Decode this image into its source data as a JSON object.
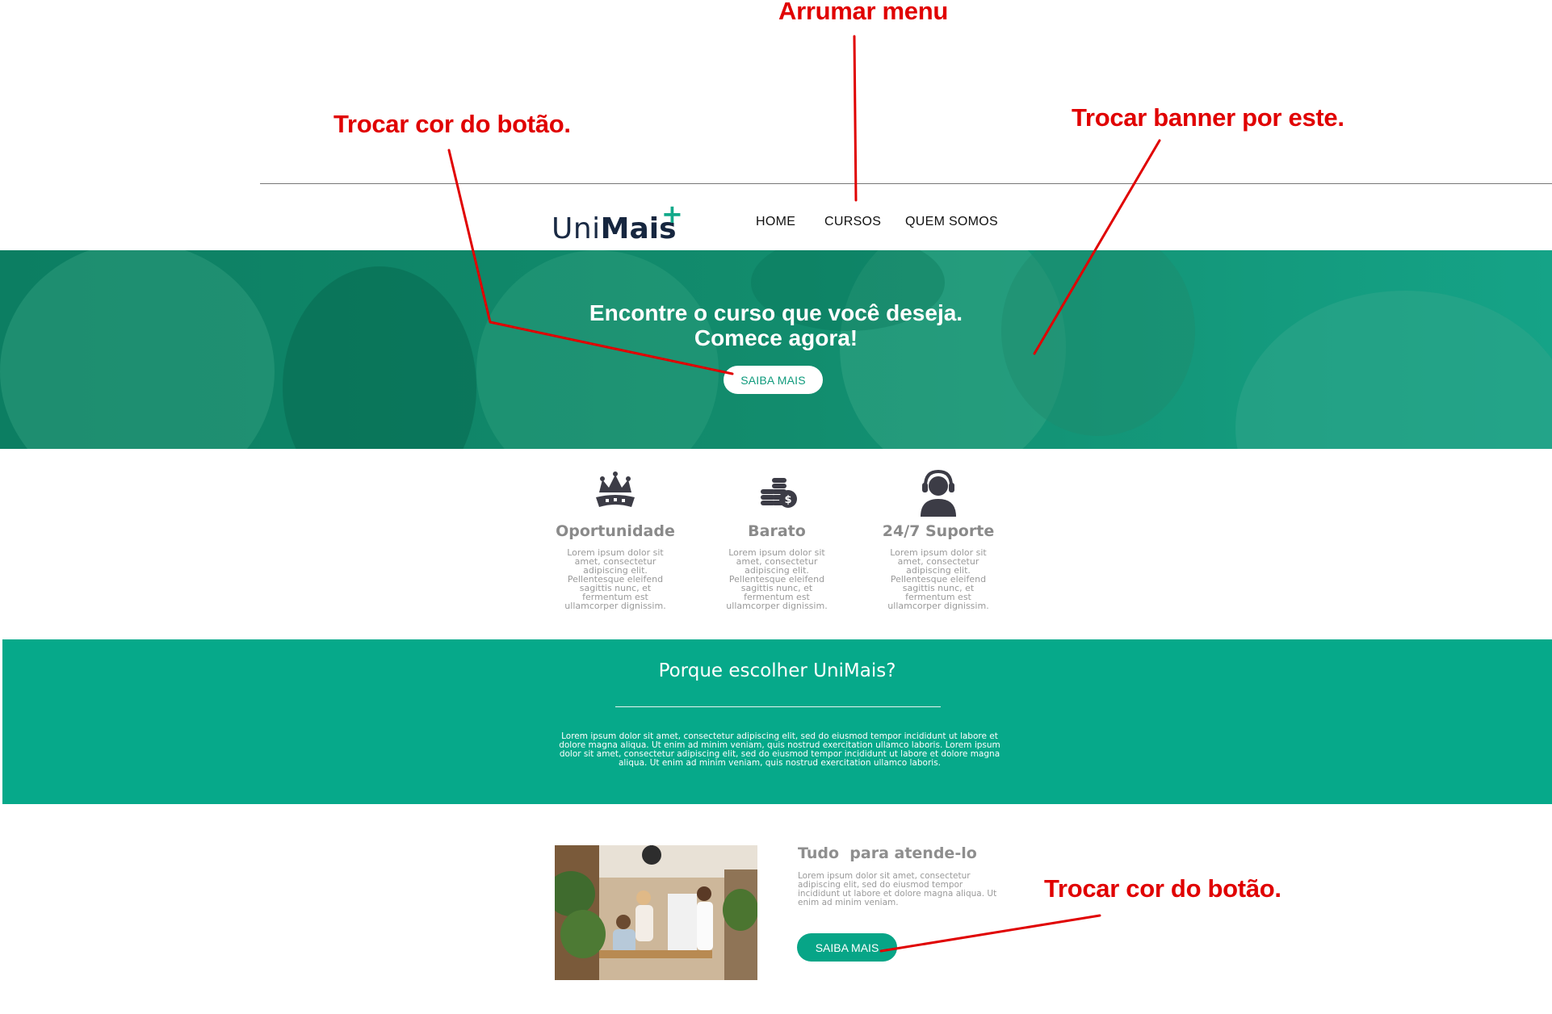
{
  "annotations": {
    "fix_menu": "Arrumar menu",
    "change_button_color_top": "Trocar cor do botão.",
    "change_banner": "Trocar banner por este.",
    "change_button_color_bottom": "Trocar cor do botão."
  },
  "header": {
    "logo_light": "Uni",
    "logo_bold": "Mais",
    "logo_plus": "+",
    "nav": [
      "HOME",
      "CURSOS",
      "QUEM SOMOS"
    ]
  },
  "hero": {
    "title_line1": "Encontre o curso que você deseja.",
    "title_line2": "Comece agora!",
    "button": "SAIBA MAIS"
  },
  "features": [
    {
      "icon": "crown-icon",
      "title": "Oportunidade",
      "text": "Lorem ipsum dolor sit amet, consectetur adipiscing elit. Pellentesque eleifend sagittis nunc, et fermentum est ullamcorper dignissim."
    },
    {
      "icon": "coins-icon",
      "title": "Barato",
      "text": "Lorem ipsum dolor sit amet, consectetur adipiscing elit. Pellentesque eleifend sagittis nunc, et fermentum est ullamcorper dignissim."
    },
    {
      "icon": "headset-icon",
      "title": "24/7 Suporte",
      "text": "Lorem ipsum dolor sit amet, consectetur adipiscing elit. Pellentesque eleifend sagittis nunc, et fermentum est ullamcorper dignissim."
    }
  ],
  "why": {
    "title": "Porque escolher UniMais?",
    "text": "Lorem ipsum dolor sit amet, consectetur adipiscing elit, sed do eiusmod tempor incididunt ut labore et dolore magna aliqua. Ut enim ad minim veniam, quis nostrud exercitation ullamco laboris. Lorem ipsum dolor sit amet, consectetur adipiscing elit, sed do eiusmod tempor incididunt ut labore et dolore magna aliqua. Ut enim ad minim veniam, quis nostrud exercitation ullamco laboris."
  },
  "bottom": {
    "title": "Tudo  para atende-lo",
    "text": "Lorem ipsum dolor sit amet, consectetur adipiscing elit, sed do eiusmod tempor incididunt ut labore et dolore magna aliqua. Ut enim ad minim veniam.",
    "button": "SAIBA MAIS"
  },
  "colors": {
    "annotation": "#e00000",
    "brand_green": "#06a98a",
    "logo_navy": "#16263f"
  }
}
